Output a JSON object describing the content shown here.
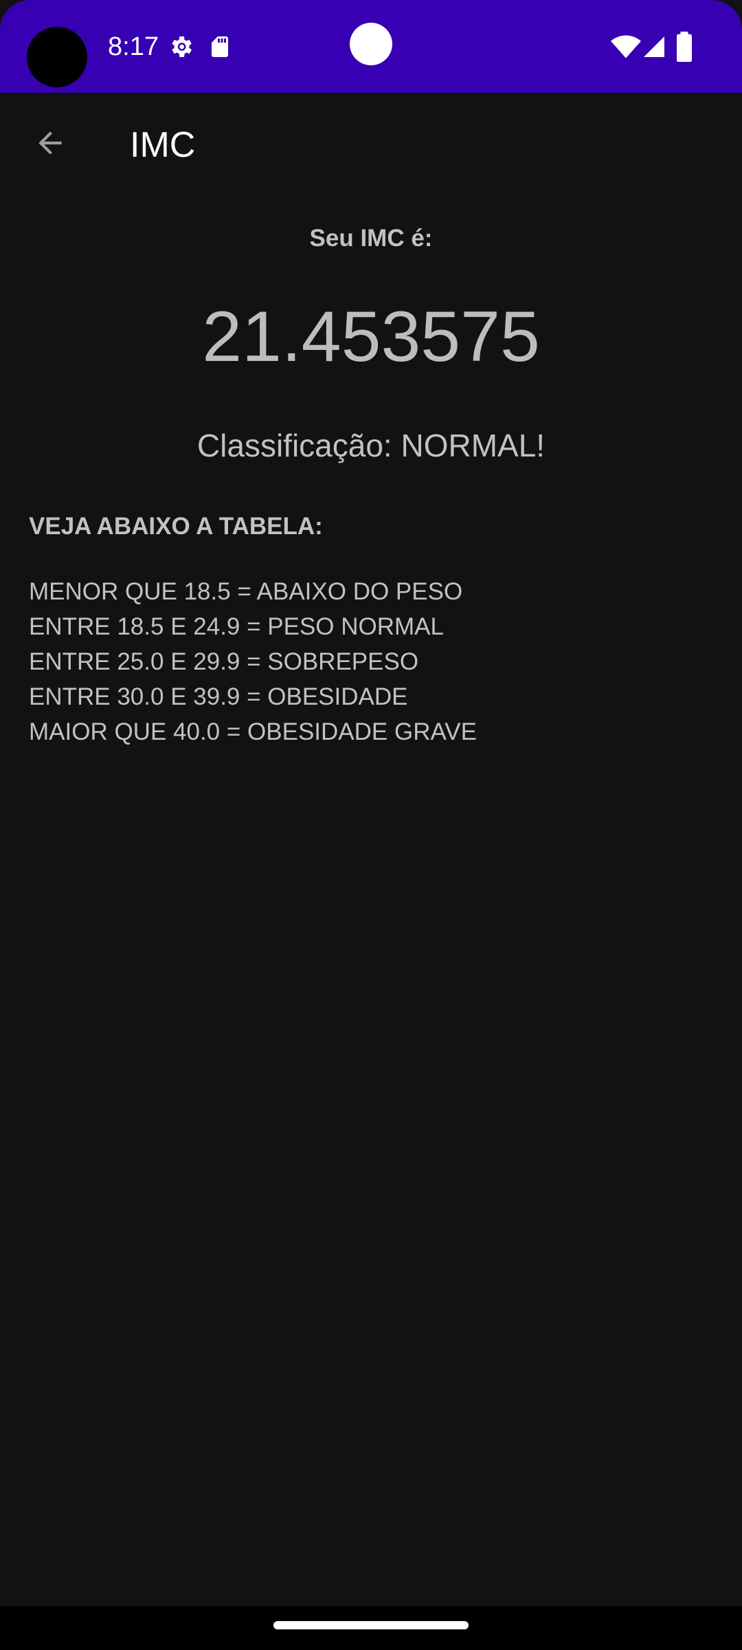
{
  "status_bar": {
    "time": "8:17",
    "icons": [
      "settings-gear-icon",
      "sd-card-icon",
      "wifi-icon",
      "cellular-signal-icon",
      "battery-icon"
    ],
    "background_color": "#3700b3"
  },
  "app_bar": {
    "title": "IMC",
    "back_icon": "arrow-back-icon"
  },
  "result": {
    "label": "Seu IMC é:",
    "value": "21.453575",
    "classification": "Classificação: NORMAL!"
  },
  "reference_table": {
    "heading": "VEJA ABAIXO A TABELA:",
    "rows": [
      "MENOR QUE 18.5 = ABAIXO DO PESO",
      "ENTRE 18.5 E 24.9 = PESO NORMAL",
      "ENTRE 25.0 E 29.9 = SOBREPESO",
      "ENTRE 30.0 E 39.9 = OBESIDADE",
      "MAIOR QUE 40.0 = OBESIDADE GRAVE"
    ]
  },
  "theme": {
    "background": "#121212",
    "text": "#c2c2c2"
  }
}
